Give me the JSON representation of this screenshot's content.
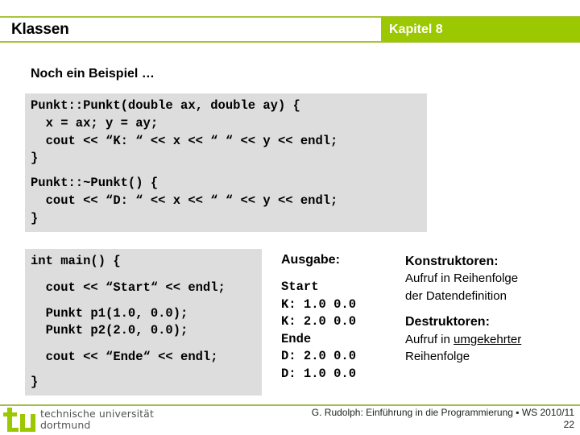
{
  "header": {
    "title": "Klassen",
    "chapter": "Kapitel 8",
    "accent_color": "#9bc800"
  },
  "subtitle": "Noch ein Beispiel …",
  "code_top": {
    "lines": [
      "Punkt::Punkt(double ax, double ay) {",
      "  x = ax; y = ay;",
      "  cout << “K: “ << x << “ “ << y << endl;",
      "}",
      "Punkt::~Punkt() {",
      "  cout << “D: “ << x << “ “ << y << endl;",
      "}"
    ]
  },
  "code_main": {
    "lines": [
      "int main() {",
      "  cout << “Start“ << endl;",
      "  Punkt p1(1.0, 0.0);",
      "  Punkt p2(2.0, 0.0);",
      "  cout << “Ende“ << endl;",
      "}"
    ]
  },
  "output": {
    "heading": "Ausgabe:",
    "lines": [
      "Start",
      "K: 1.0 0.0",
      "K: 2.0 0.0",
      "Ende",
      "D: 2.0 0.0",
      "D: 1.0 0.0"
    ]
  },
  "notes": {
    "constructors_heading": "Konstruktoren:",
    "constructors_line1": "Aufruf in Reihenfolge",
    "constructors_line2": "der Datendefinition",
    "destructors_heading": "Destruktoren:",
    "destructors_line1_prefix": "Aufruf in ",
    "destructors_line1_emphasis": "umgekehrter",
    "destructors_line2": "Reihenfolge"
  },
  "footer": {
    "university_line1": "technische universität",
    "university_line2": "dortmund",
    "credit": "G. Rudolph: Einführung in die Programmierung ▪ WS 2010/11",
    "page_number": "22",
    "logo_icon": "tu-logo-icon"
  }
}
